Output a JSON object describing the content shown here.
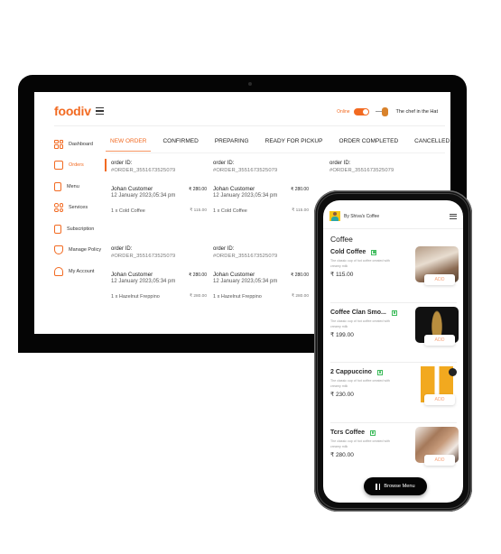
{
  "dashboard": {
    "logo": "foodiv",
    "status_label": "Online",
    "status_on": true,
    "chef_name": "The chef in the Hat",
    "sidebar": [
      {
        "label": "Dashboard",
        "icon": "dashboard-icon",
        "active": false
      },
      {
        "label": "Orders",
        "icon": "orders-icon",
        "active": true
      },
      {
        "label": "Menu",
        "icon": "menu-icon",
        "active": false
      },
      {
        "label": "Services",
        "icon": "services-icon",
        "active": false
      },
      {
        "label": "Subscription",
        "icon": "subscription-icon",
        "active": false
      },
      {
        "label": "Manage Policy",
        "icon": "shield-icon",
        "active": false
      },
      {
        "label": "My Account",
        "icon": "user-icon",
        "active": false
      }
    ],
    "tabs": [
      {
        "label": "NEW ORDER",
        "active": true
      },
      {
        "label": "CONFIRMED",
        "active": false
      },
      {
        "label": "PREPARING",
        "active": false
      },
      {
        "label": "READY FOR PICKUP",
        "active": false
      },
      {
        "label": "ORDER COMPLETED",
        "active": false
      },
      {
        "label": "CANCELLED",
        "active": false
      }
    ],
    "orders": [
      {
        "id_label": "order ID:",
        "id": "#ORDER_3551673525079",
        "customer": "Johan Customer",
        "total": "₹ 280.00",
        "date": "12 January 2023,05:34 pm",
        "item": "1 x Cold Coffee",
        "item_price": "₹  115.00"
      },
      {
        "id_label": "order ID:",
        "id": "#ORDER_3551673525079",
        "customer": "Johan Customer",
        "total": "₹ 280.00",
        "date": "12 January 2023,05:34 pm",
        "item": "1 x Cold Coffee",
        "item_price": "₹ 115.00"
      },
      {
        "id_label": "order ID:",
        "id": "#ORDER_3551673525079"
      },
      {
        "id_label": "order ID:",
        "id": "#ORDER_3551673525079",
        "customer": "Johan Customer",
        "total": "₹ 280.00",
        "date": "12 January 2023,05:34 pm",
        "item": "1 x Hazelnut Freppino",
        "item_price": "₹ 280.00"
      },
      {
        "id_label": "order ID:",
        "id": "#ORDER_3551673525079",
        "customer": "Johan Customer",
        "total": "₹ 280.00",
        "date": "12 January 2023,05:34 pm",
        "item": "1 x Hazelnut Freppino",
        "item_price": "₹ 280.00"
      }
    ]
  },
  "phone": {
    "brand": "By Shiva's Coffee",
    "section": "Coffee",
    "items": [
      {
        "name": "Cold Coffee",
        "desc": "The classic cup of hot coffee created with creamy milk",
        "price": "₹ 115.00",
        "add": "ADD",
        "veg": true
      },
      {
        "name": "Coffee Clan Smo...",
        "desc": "The classic cup of hot coffee created with creamy milk",
        "price": "₹ 199.00",
        "add": "ADD",
        "veg": true
      },
      {
        "name": "2 Cappuccino",
        "desc": "The classic cup of hot coffee created with creamy milk",
        "price": "₹ 230.00",
        "add": "ADD",
        "veg": true
      },
      {
        "name": "Tcrs Coffee",
        "desc": "The classic cup of hot coffee created with creamy milk",
        "price": "₹ 280.00",
        "add": "ADD",
        "veg": true
      }
    ],
    "browse_label": "Browse Menu"
  },
  "colors": {
    "accent": "#f26a21",
    "veg": "#3dbb5b",
    "frame": "#050505"
  }
}
